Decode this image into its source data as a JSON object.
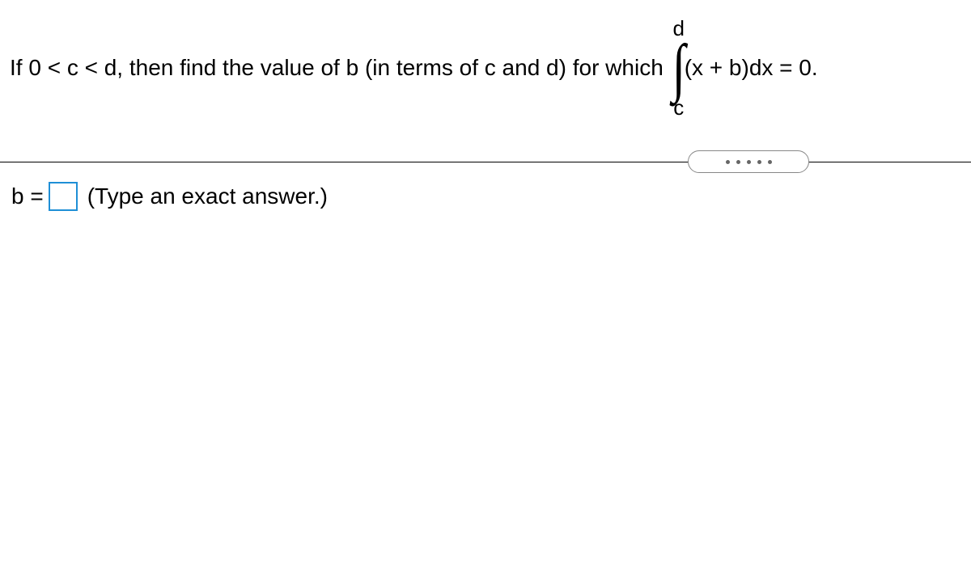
{
  "problem": {
    "prefix": "If 0 < c < d, then find the value of b (in terms of c and d) for which ",
    "integral": {
      "upper": "d",
      "lower": "c",
      "integrand": "(x + b)dx = 0."
    }
  },
  "answer": {
    "label": "b =",
    "value": "",
    "hint": "(Type an exact answer.)"
  }
}
